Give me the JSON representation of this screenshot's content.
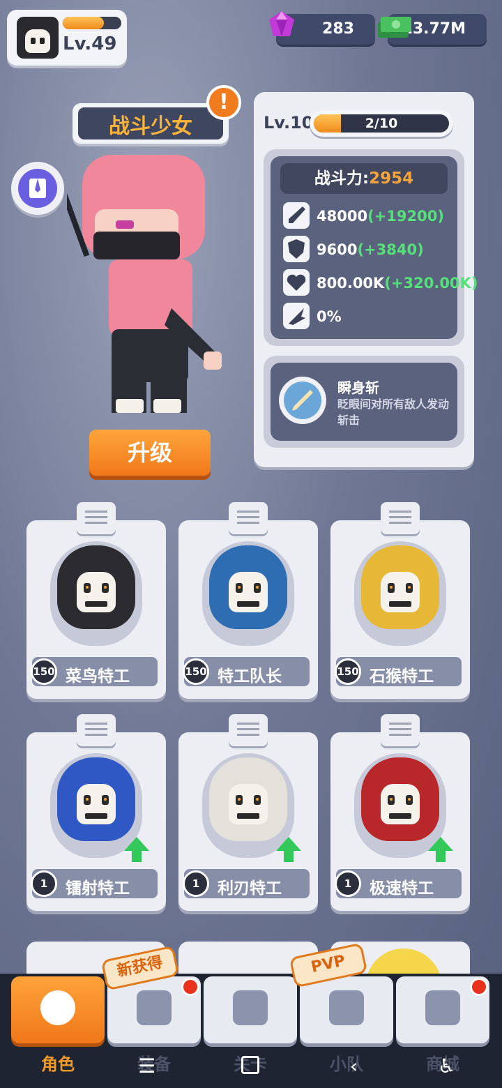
{
  "player": {
    "level": "Lv.49",
    "xp_fraction": 0.7
  },
  "currency": {
    "gems": "283",
    "cash": "13.77M"
  },
  "hero": {
    "name": "战斗少女",
    "alert": "!",
    "upgrade_label": "升级"
  },
  "stats": {
    "level": "Lv.10",
    "progress": "2/10",
    "progress_fraction": 0.2,
    "power_label": "战斗力:",
    "power_value": "2954",
    "rows": [
      {
        "icon": "sword-icon",
        "value": "48000",
        "bonus": "(+19200)"
      },
      {
        "icon": "shield-icon",
        "value": "9600",
        "bonus": "(+3840)"
      },
      {
        "icon": "heart-icon",
        "value": "800.00K",
        "bonus": "(+320.00K)"
      },
      {
        "icon": "claw-icon",
        "value": "0%",
        "bonus": ""
      }
    ],
    "skill": {
      "name": "瞬身斩",
      "desc": "眨眼间对所有敌人发动斩击",
      "icon": "dash-slash-icon"
    }
  },
  "cards": [
    {
      "count": "150",
      "name": "菜鸟特工",
      "hood": "#2b2b30",
      "upgrade": false
    },
    {
      "count": "150",
      "name": "特工队长",
      "hood": "#2f6db3",
      "upgrade": false
    },
    {
      "count": "150",
      "name": "石猴特工",
      "hood": "#e6b836",
      "upgrade": false
    },
    {
      "count": "1",
      "name": "镭射特工",
      "hood": "#2f58c4",
      "upgrade": true
    },
    {
      "count": "1",
      "name": "利刃特工",
      "hood": "#e3e1da",
      "upgrade": true
    },
    {
      "count": "1",
      "name": "极速特工",
      "hood": "#b8272a",
      "upgrade": true
    }
  ],
  "nav": {
    "tabs": [
      {
        "label": "角色",
        "icon": "skull-icon",
        "active": true
      },
      {
        "label": "装备",
        "icon": "gun-icon",
        "badge_text": "新获得",
        "dot": true
      },
      {
        "label": "关卡",
        "icon": "map-icon"
      },
      {
        "label": "小队",
        "icon": "squad-icon",
        "badge_text": "PVP"
      },
      {
        "label": "商城",
        "icon": "shop-icon",
        "dot": true
      }
    ]
  },
  "colors": {
    "accent": "#f0781a",
    "bonus": "#55e07a",
    "power": "#f7a43a"
  }
}
